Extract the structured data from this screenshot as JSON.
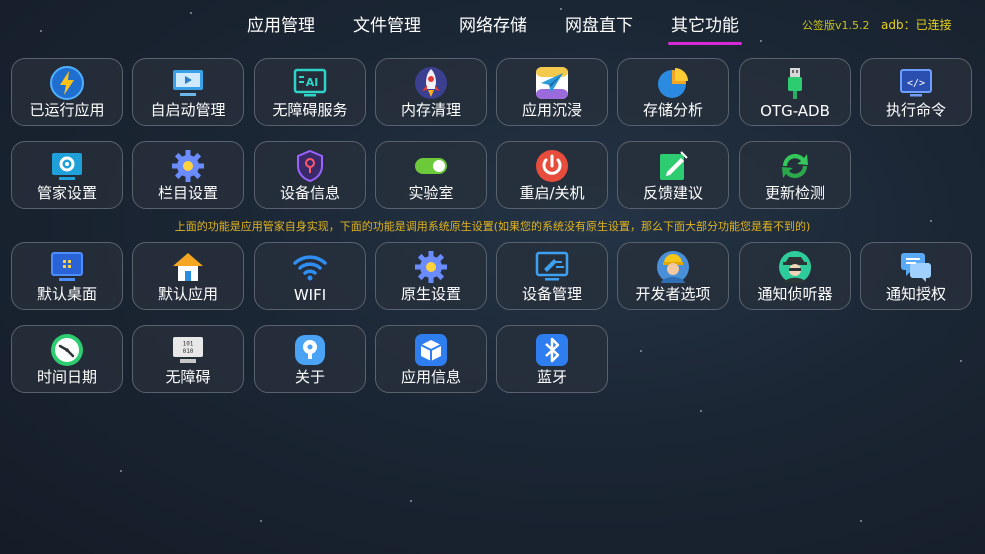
{
  "nav": {
    "tabs": [
      {
        "label": "应用管理",
        "active": false
      },
      {
        "label": "文件管理",
        "active": false
      },
      {
        "label": "网络存储",
        "active": false
      },
      {
        "label": "网盘直下",
        "active": false
      },
      {
        "label": "其它功能",
        "active": true
      }
    ],
    "active_color": "#d62ad9"
  },
  "status": {
    "version": "公签版v1.5.2",
    "adb_label": "adb：已连接"
  },
  "notice": "上面的功能是应用管家自身实现，下面的功能是调用系统原生设置(如果您的系统没有原生设置，那么下面大部分功能您是看不到的)",
  "tiles_top": [
    {
      "label": "已运行应用",
      "icon": "lightning-icon"
    },
    {
      "label": "自启动管理",
      "icon": "monitor-play-icon"
    },
    {
      "label": "无障碍服务",
      "icon": "ai-screen-icon"
    },
    {
      "label": "内存清理",
      "icon": "rocket-icon"
    },
    {
      "label": "应用沉浸",
      "icon": "paper-plane-icon"
    },
    {
      "label": "存储分析",
      "icon": "pie-chart-icon"
    },
    {
      "label": "OTG-ADB",
      "icon": "usb-icon"
    },
    {
      "label": "执行命令",
      "icon": "code-icon"
    },
    {
      "label": "管家设置",
      "icon": "settings-screen-icon"
    },
    {
      "label": "栏目设置",
      "icon": "gear-icon"
    },
    {
      "label": "设备信息",
      "icon": "location-shield-icon"
    },
    {
      "label": "实验室",
      "icon": "toggle-icon"
    },
    {
      "label": "重启/关机",
      "icon": "power-icon"
    },
    {
      "label": "反馈建议",
      "icon": "edit-icon"
    },
    {
      "label": "更新检测",
      "icon": "refresh-icon"
    }
  ],
  "tiles_bottom": [
    {
      "label": "默认桌面",
      "icon": "desktop-icon"
    },
    {
      "label": "默认应用",
      "icon": "home-icon"
    },
    {
      "label": "WIFI",
      "icon": "wifi-icon"
    },
    {
      "label": "原生设置",
      "icon": "gear-icon"
    },
    {
      "label": "设备管理",
      "icon": "device-manage-icon"
    },
    {
      "label": "开发者选项",
      "icon": "developer-avatar-icon"
    },
    {
      "label": "通知侦听器",
      "icon": "detective-icon"
    },
    {
      "label": "通知授权",
      "icon": "chat-bubble-icon"
    },
    {
      "label": "时间日期",
      "icon": "clock-icon"
    },
    {
      "label": "无障碍",
      "icon": "binary-screen-icon"
    },
    {
      "label": "关于",
      "icon": "info-icon"
    },
    {
      "label": "应用信息",
      "icon": "box-icon"
    },
    {
      "label": "蓝牙",
      "icon": "bluetooth-icon"
    }
  ],
  "colors": {
    "tile_border": "#59616c",
    "notice_text": "#e0b420",
    "version_text": "#c9c21a",
    "adb_text": "#e8d21c"
  }
}
